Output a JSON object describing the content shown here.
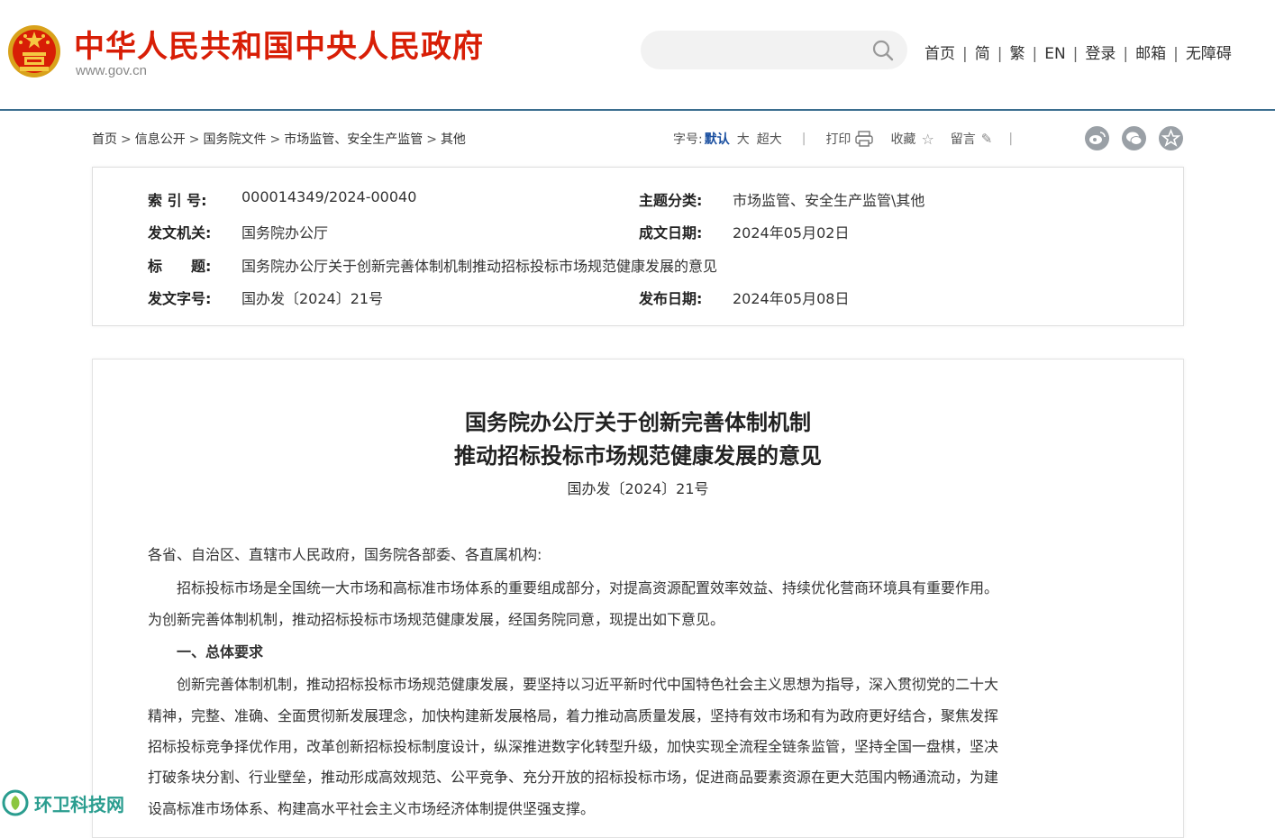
{
  "header": {
    "site_title": "中华人民共和国中央人民政府",
    "site_domain": "www.gov.cn",
    "search": {
      "value": "",
      "placeholder": ""
    },
    "nav": [
      "首页",
      "简",
      "繁",
      "EN",
      "登录",
      "邮箱",
      "无障碍"
    ]
  },
  "breadcrumb": [
    "首页",
    "信息公开",
    "国务院文件",
    "市场监管、安全生产监管",
    "其他"
  ],
  "toolbar": {
    "font_size_label": "字号:",
    "font_default": "默认",
    "font_large": "大",
    "font_xlarge": "超大",
    "print": "打印",
    "favorite": "收藏",
    "comment": "留言"
  },
  "meta": {
    "index_label": "索 引 号:",
    "index_value": "000014349/2024-00040",
    "topic_label": "主题分类:",
    "topic_value": "市场监管、安全生产监管\\其他",
    "issuer_label": "发文机关:",
    "issuer_value": "国务院办公厅",
    "written_label": "成文日期:",
    "written_value": "2024年05月02日",
    "title_label": "标　　题:",
    "title_value": "国务院办公厅关于创新完善体制机制推动招标投标市场规范健康发展的意见",
    "docno_label": "发文字号:",
    "docno_value": "国办发〔2024〕21号",
    "published_label": "发布日期:",
    "published_value": "2024年05月08日"
  },
  "article": {
    "title_line1": "国务院办公厅关于创新完善体制机制",
    "title_line2": "推动招标投标市场规范健康发展的意见",
    "doc_number": "国办发〔2024〕21号",
    "paragraphs": [
      "各省、自治区、直辖市人民政府，国务院各部委、各直属机构:",
      "　　招标投标市场是全国统一大市场和高标准市场体系的重要组成部分，对提高资源配置效率效益、持续优化营商环境具有重要作用。",
      "为创新完善体制机制，推动招标投标市场规范健康发展，经国务院同意，现提出如下意见。",
      "　　一、总体要求",
      "　　创新完善体制机制，推动招标投标市场规范健康发展，要坚持以习近平新时代中国特色社会主义思想为指导，深入贯彻党的二十大",
      "精神，完整、准确、全面贯彻新发展理念，加快构建新发展格局，着力推动高质量发展，坚持有效市场和有为政府更好结合，聚焦发挥",
      "招标投标竞争择优作用，改革创新招标投标制度设计，纵深推进数字化转型升级，加快实现全流程全链条监管，坚持全国一盘棋，坚决",
      "打破条块分割、行业壁垒，推动形成高效规范、公平竞争、充分开放的招标投标市场，促进商品要素资源在更大范围内畅通流动，为建",
      "设高标准市场体系、构建高水平社会主义市场经济体制提供坚强支撑。"
    ]
  },
  "watermark": "环卫科技网",
  "colors": {
    "brand_red": "#d81e06",
    "header_rule": "#3b6e8f",
    "accent_blue": "#1a4fa0",
    "watermark_green": "#2a9d8f"
  }
}
